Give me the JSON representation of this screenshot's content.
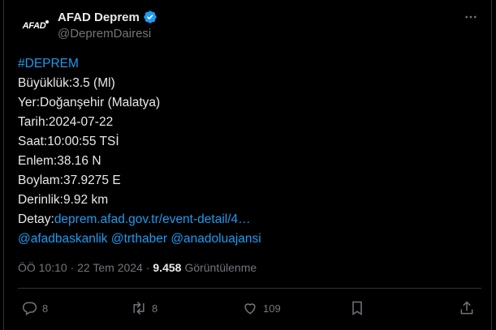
{
  "tweet": {
    "author_name": "AFAD Deprem",
    "handle": "@DepremDairesi",
    "avatar_text": "AFAD",
    "lines": {
      "hashtag": "#DEPREM",
      "magnitude": "Büyüklük:3.5 (Ml)",
      "location": "Yer:Doğanşehir (Malatya)",
      "date": "Tarih:2024-07-22",
      "time": "Saat:10:00:55 TSİ",
      "lat": "Enlem:38.16 N",
      "lon": "Boylam:37.9275 E",
      "depth": "Derinlik:9.92 km",
      "detail_label": "Detay:",
      "detail_link": "deprem.afad.gov.tr/event-detail/4…",
      "mention1": "@afadbaskanlik",
      "mention2": "@trthaber",
      "mention3": "@anadoluajansi"
    },
    "timestamp": "ÖÖ 10:10 · 22 Tem 2024 ·",
    "views_count": "9.458",
    "views_label": "Görüntülenme"
  },
  "actions": {
    "replies": "8",
    "retweets": "8",
    "likes": "109"
  },
  "colors": {
    "accent": "#1d9bf0",
    "muted": "#71767b",
    "text": "#e7e9ea",
    "background": "#000000"
  },
  "icons": [
    "verified-badge-icon",
    "more-icon",
    "reply-icon",
    "retweet-icon",
    "like-icon",
    "bookmark-icon",
    "share-icon"
  ]
}
